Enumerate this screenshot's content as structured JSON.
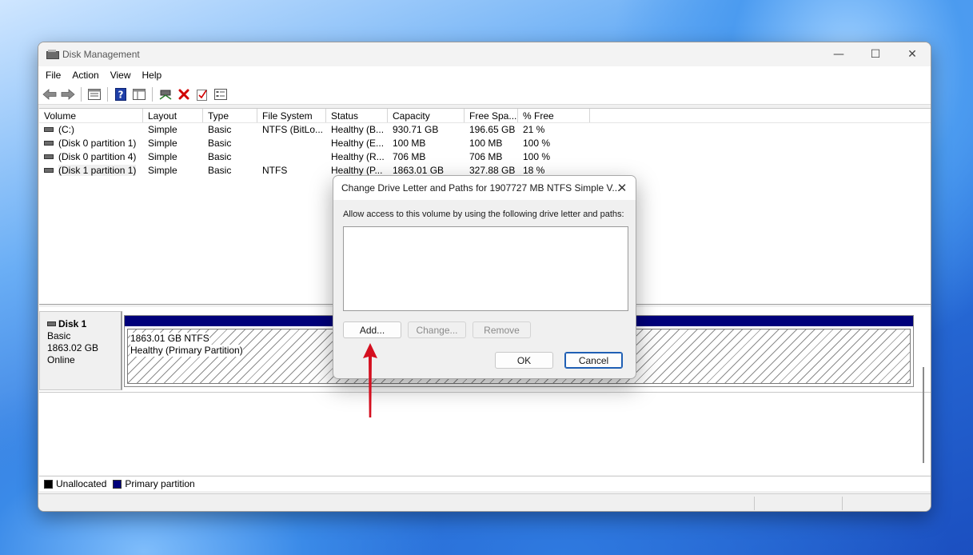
{
  "window": {
    "title": "Disk Management",
    "controls": {
      "minimize": "—",
      "maximize": "☐",
      "close": "✕"
    }
  },
  "menu": [
    "File",
    "Action",
    "View",
    "Help"
  ],
  "toolbar": {
    "icons": [
      "back-icon",
      "forward-icon",
      "properties-icon",
      "help-icon",
      "show-pane-icon",
      "connect-disk-icon",
      "delete-icon",
      "check-icon",
      "settings-list-icon"
    ],
    "delete_color": "#d10000",
    "help_color": "#1f3fa8"
  },
  "volume_table": {
    "columns": [
      "Volume",
      "Layout",
      "Type",
      "File System",
      "Status",
      "Capacity",
      "Free Spa...",
      "% Free"
    ],
    "rows": [
      [
        "(C:)",
        "Simple",
        "Basic",
        "NTFS (BitLo...",
        "Healthy (B...",
        "930.71 GB",
        "196.65 GB",
        "21 %"
      ],
      [
        "(Disk 0 partition 1)",
        "Simple",
        "Basic",
        "",
        "Healthy (E...",
        "100 MB",
        "100 MB",
        "100 %"
      ],
      [
        "(Disk 0 partition 4)",
        "Simple",
        "Basic",
        "",
        "Healthy (R...",
        "706 MB",
        "706 MB",
        "100 %"
      ],
      [
        "(Disk 1 partition 1)",
        "Simple",
        "Basic",
        "NTFS",
        "Healthy (P...",
        "1863.01 GB",
        "327.88 GB",
        "18 %"
      ]
    ]
  },
  "disk": {
    "name": "Disk 1",
    "type": "Basic",
    "size": "1863.02 GB",
    "state": "Online",
    "partition_size": "1863.01 GB NTFS",
    "partition_status": "Healthy (Primary Partition)"
  },
  "legend": {
    "unallocated": "Unallocated",
    "primary": "Primary partition",
    "unallocated_color": "#000000",
    "primary_color": "#00007a"
  },
  "dialog": {
    "title": "Change Drive Letter and Paths for 1907727 MB NTFS Simple V...",
    "description": "Allow access to this volume by using the following drive letter and paths:",
    "add": "Add...",
    "change": "Change...",
    "remove": "Remove",
    "ok": "OK",
    "cancel": "Cancel"
  },
  "annotation": {
    "arrow_color": "#d40f1f"
  }
}
